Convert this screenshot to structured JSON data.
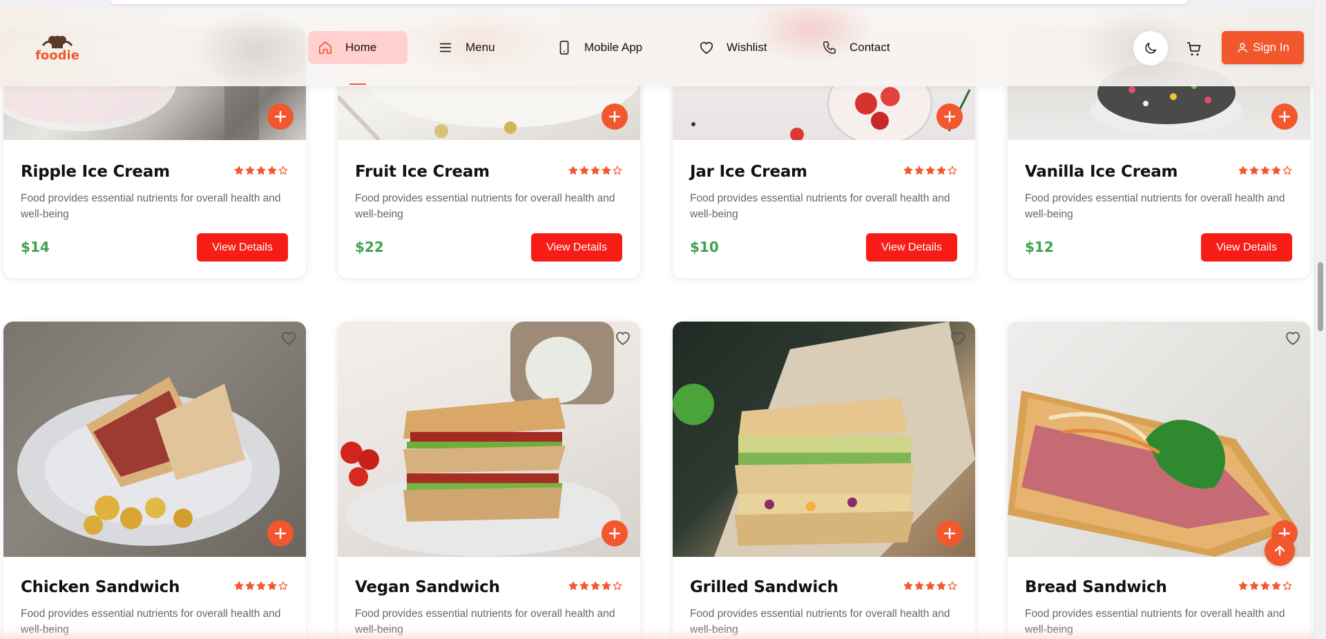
{
  "brand": {
    "name": "foodie",
    "accent": "#f2572d"
  },
  "nav": {
    "items": [
      {
        "label": "Home",
        "icon": "home-icon",
        "active": true
      },
      {
        "label": "Menu",
        "icon": "menu-icon"
      },
      {
        "label": "Mobile App",
        "icon": "mobile-icon"
      },
      {
        "label": "Wishlist",
        "icon": "heart-icon"
      },
      {
        "label": "Contact",
        "icon": "phone-icon"
      }
    ],
    "theme_toggle_icon": "moon-icon",
    "cart_icon": "cart-icon",
    "sign_in_label": "Sign In"
  },
  "products": [
    {
      "name": "Ripple Ice Cream",
      "rating": 4,
      "max_rating": 5,
      "description": "Food provides essential nutrients for overall health and well-being",
      "price": "$14",
      "button": "View Details"
    },
    {
      "name": "Fruit Ice Cream",
      "rating": 4,
      "max_rating": 5,
      "description": "Food provides essential nutrients for overall health and well-being",
      "price": "$22",
      "button": "View Details"
    },
    {
      "name": "Jar Ice Cream",
      "rating": 4,
      "max_rating": 5,
      "description": "Food provides essential nutrients for overall health and well-being",
      "price": "$10",
      "button": "View Details"
    },
    {
      "name": "Vanilla Ice Cream",
      "rating": 4,
      "max_rating": 5,
      "description": "Food provides essential nutrients for overall health and well-being",
      "price": "$12",
      "button": "View Details"
    },
    {
      "name": "Chicken Sandwich",
      "rating": 4,
      "max_rating": 5,
      "description": "Food provides essential nutrients for overall health and well-being"
    },
    {
      "name": "Vegan Sandwich",
      "rating": 4,
      "max_rating": 5,
      "description": "Food provides essential nutrients for overall health and well-being"
    },
    {
      "name": "Grilled Sandwich",
      "rating": 4,
      "max_rating": 5,
      "description": "Food provides essential nutrients for overall health and well-being"
    },
    {
      "name": "Bread Sandwich",
      "rating": 4,
      "max_rating": 5,
      "description": "Food provides essential nutrients for overall health and well-being"
    }
  ],
  "colors": {
    "price": "#3fa34d",
    "button": "#f71d16",
    "star": "#f2572d",
    "active_nav_bg": "#ffd0ce"
  }
}
